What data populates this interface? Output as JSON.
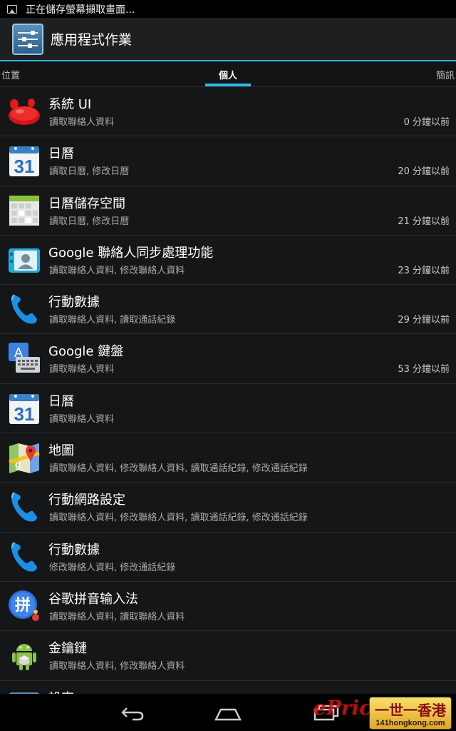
{
  "status_bar": {
    "notification_text": "正在儲存螢幕擷取畫面..."
  },
  "action_bar": {
    "title": "應用程式作業"
  },
  "tabs": {
    "left": "位置",
    "center": "個人",
    "right": "簡訊"
  },
  "rows": [
    {
      "icon": "jellybean-icon",
      "name": "系統 UI",
      "perm": "讀取聯絡人資料",
      "time": "0 分鐘以前"
    },
    {
      "icon": "calendar-icon",
      "name": "日曆",
      "perm": "讀取日曆, 修改日曆",
      "time": "20 分鐘以前"
    },
    {
      "icon": "calendar-storage-icon",
      "name": "日曆儲存空間",
      "perm": "讀取日曆, 修改日曆",
      "time": "21 分鐘以前"
    },
    {
      "icon": "contacts-sync-icon",
      "name": "Google 聯絡人同步處理功能",
      "perm": "讀取聯絡人資料, 修改聯絡人資料",
      "time": "23 分鐘以前"
    },
    {
      "icon": "phone-icon",
      "name": "行動數據",
      "perm": "讀取聯絡人資料, 讀取通話紀錄",
      "time": "29 分鐘以前"
    },
    {
      "icon": "keyboard-icon",
      "name": "Google 鍵盤",
      "perm": "讀取聯絡人資料",
      "time": "53 分鐘以前"
    },
    {
      "icon": "calendar-icon",
      "name": "日曆",
      "perm": "讀取聯絡人資料",
      "time": ""
    },
    {
      "icon": "maps-icon",
      "name": "地圖",
      "perm": "讀取聯絡人資料, 修改聯絡人資料, 讀取通話紀錄, 修改通話紀錄",
      "time": ""
    },
    {
      "icon": "phone-icon",
      "name": "行動網路設定",
      "perm": "讀取聯絡人資料, 修改聯絡人資料, 讀取通話紀錄, 修改通話紀錄",
      "time": ""
    },
    {
      "icon": "phone-icon",
      "name": "行動數據",
      "perm": "修改聯絡人資料, 修改通話紀錄",
      "time": ""
    },
    {
      "icon": "pinyin-ime-icon",
      "name": "谷歌拼音输入法",
      "perm": "讀取聯絡人資料, 讀取聯絡人資料",
      "time": ""
    },
    {
      "icon": "android-icon",
      "name": "金鑰鏈",
      "perm": "讀取聯絡人資料, 修改聯絡人資料",
      "time": ""
    },
    {
      "icon": "settings-icon",
      "name": "設定",
      "perm": "",
      "time": ""
    }
  ],
  "watermark": {
    "brand": "ePrice",
    "site_top": "一世一香港",
    "site_bottom": "141hongkong.com"
  }
}
